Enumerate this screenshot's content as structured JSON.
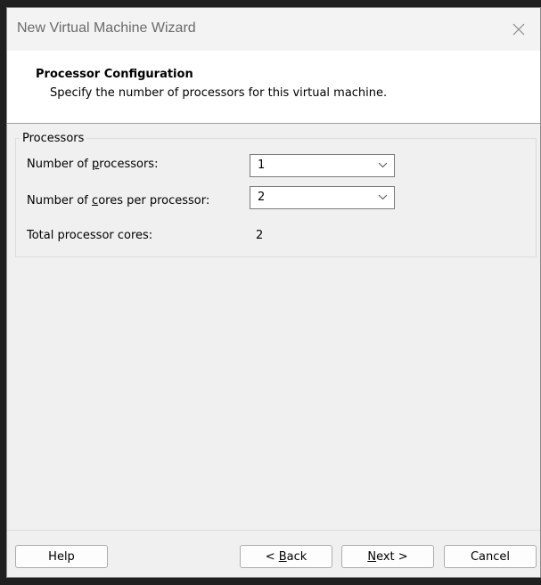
{
  "window": {
    "title": "New Virtual Machine Wizard"
  },
  "header": {
    "title": "Processor Configuration",
    "subtitle": "Specify the number of processors for this virtual machine."
  },
  "processors": {
    "group_label": "Processors",
    "num_processors": {
      "label_pre": "Number of ",
      "label_accel": "p",
      "label_post": "rocessors:",
      "value": "1"
    },
    "cores_per_processor": {
      "label_pre": "Number of ",
      "label_accel": "c",
      "label_post": "ores per processor:",
      "value": "2"
    },
    "total_cores": {
      "label": "Total processor cores:",
      "value": "2"
    }
  },
  "buttons": {
    "help": "Help",
    "back_pre": "< ",
    "back_accel": "B",
    "back_post": "ack",
    "next_accel": "N",
    "next_post": "ext >",
    "cancel": "Cancel"
  },
  "icons": {
    "close": "close-icon",
    "dropdown": "chevron-down-icon"
  }
}
